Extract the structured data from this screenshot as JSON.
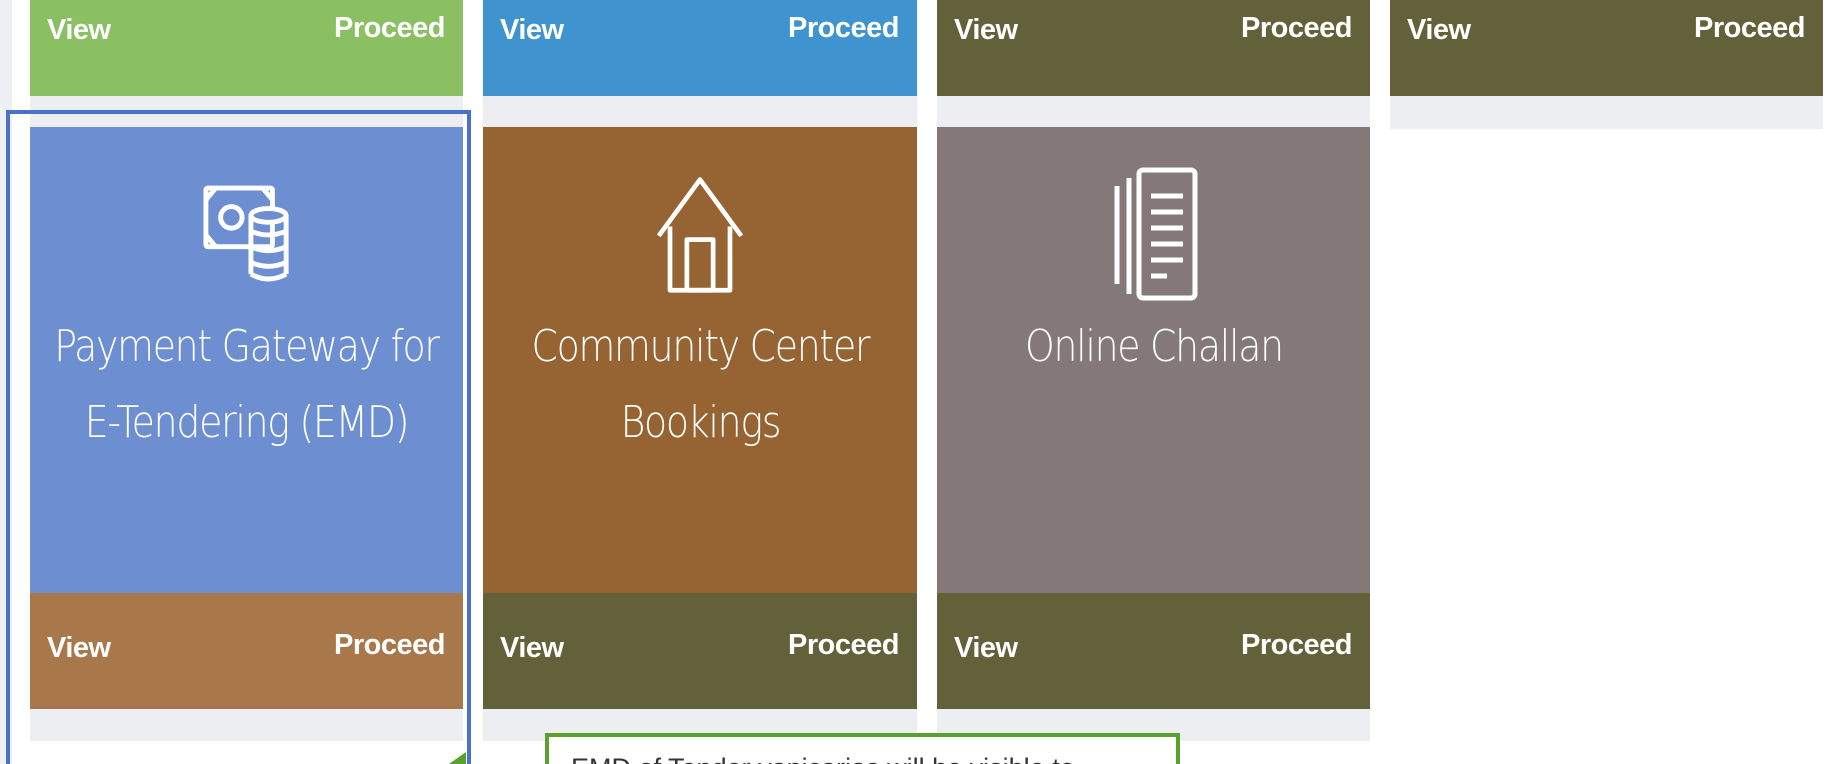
{
  "top_row": [
    {
      "view": "View",
      "proceed": "Proceed",
      "color": "#8abf62"
    },
    {
      "view": "View",
      "proceed": "Proceed",
      "color": "#3f94d0"
    },
    {
      "view": "View",
      "proceed": "Proceed",
      "color": "#63613a"
    },
    {
      "view": "View",
      "proceed": "Proceed",
      "color": "#63613a"
    }
  ],
  "tiles": [
    {
      "icon": "cash-coins-icon",
      "title_line1": "Payment Gateway for",
      "title_line2": "E-Tendering (EMD)",
      "color": "#6d8fd2",
      "bar_color": "#a8784a",
      "view": "View",
      "proceed": "Proceed"
    },
    {
      "icon": "house-icon",
      "title_line1": "Community Center",
      "title_line2": "Bookings",
      "color": "#966333",
      "bar_color": "#63613a",
      "view": "View",
      "proceed": "Proceed"
    },
    {
      "icon": "document-list-icon",
      "title_line1": "Online Challan",
      "title_line2": "",
      "color": "#847878",
      "bar_color": "#63613a",
      "view": "View",
      "proceed": "Proceed"
    }
  ],
  "callout": {
    "text": "EMD of Tender vanicarias will be visible to",
    "border_color": "#5aa02c"
  },
  "highlight_color": "#4a72c9"
}
